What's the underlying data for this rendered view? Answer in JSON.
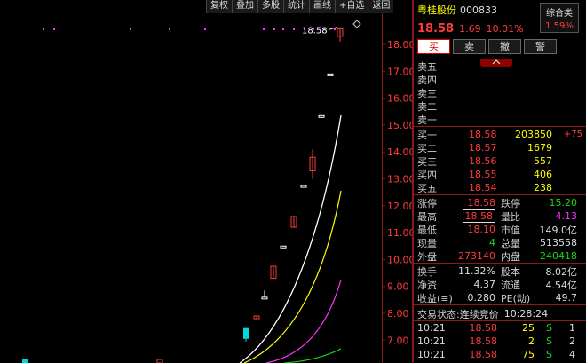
{
  "toolbar": [
    "复权",
    "叠加",
    "多股",
    "统计",
    "画线",
    "+自选",
    "返回"
  ],
  "chart": {
    "price_ticks": [
      "18.00",
      "17.00",
      "16.00",
      "15.00",
      "14.00",
      "13.00",
      "12.00",
      "11.00",
      "10.00",
      "9.00",
      "8.00",
      "7.00"
    ],
    "high_label": "18.58",
    "colors": {
      "up": "#ff3b3b",
      "down": "#00d8d8",
      "ma5": "#ffffff",
      "ma10": "#ffff00",
      "ma20": "#ff33ff",
      "ma60": "#18d818",
      "axis": "#8b1a1a"
    }
  },
  "stock": {
    "name": "粤桂股份",
    "code": "000833",
    "price": "18.58",
    "change": "1.69",
    "change_pct": "10.01%",
    "sector_name": "综合类",
    "sector_pct": "1.59%"
  },
  "trade_buttons": [
    "买",
    "卖",
    "撤",
    "警"
  ],
  "asks": [
    "卖五",
    "卖四",
    "卖三",
    "卖二",
    "卖一"
  ],
  "bids": [
    {
      "label": "买一",
      "price": "18.58",
      "vol": "203850",
      "chg": "+75"
    },
    {
      "label": "买二",
      "price": "18.57",
      "vol": "1679",
      "chg": ""
    },
    {
      "label": "买三",
      "price": "18.56",
      "vol": "557",
      "chg": ""
    },
    {
      "label": "买四",
      "price": "18.55",
      "vol": "406",
      "chg": ""
    },
    {
      "label": "买五",
      "price": "18.54",
      "vol": "238",
      "chg": ""
    }
  ],
  "quote": {
    "zhangting_l": "涨停",
    "zhangting_v": "18.58",
    "dieting_l": "跌停",
    "dieting_v": "15.20",
    "high_l": "最高",
    "high_v": "18.58",
    "liangbi_l": "量比",
    "liangbi_v": "4.13",
    "low_l": "最低",
    "low_v": "18.10",
    "shizhi_l": "市值",
    "shizhi_v": "149.0亿",
    "xianliang_l": "现量",
    "xianliang_v": "4",
    "zongliang_l": "总量",
    "zongliang_v": "513558",
    "waipan_l": "外盘",
    "waipan_v": "273140",
    "neipan_l": "内盘",
    "neipan_v": "240418",
    "huanshou_l": "换手",
    "huanshou_v": "11.32%",
    "guben_l": "股本",
    "guben_v": "8.02亿",
    "jingzi_l": "净资",
    "jingzi_v": "4.37",
    "liutong_l": "流通",
    "liutong_v": "4.54亿",
    "shouyi_l": "收益(≡)",
    "shouyi_v": "0.280",
    "pe_l": "PE(动)",
    "pe_v": "49.7"
  },
  "status": {
    "label": "交易状态:",
    "value": "连续竞价",
    "time": "10:28:24"
  },
  "ticks": [
    {
      "time": "10:21",
      "price": "18.58",
      "vol": "25",
      "flag": "S",
      "n": "1"
    },
    {
      "time": "10:21",
      "price": "18.58",
      "vol": "2",
      "flag": "S",
      "n": "2"
    },
    {
      "time": "10:21",
      "price": "18.58",
      "vol": "75",
      "flag": "S",
      "n": "4"
    }
  ]
}
